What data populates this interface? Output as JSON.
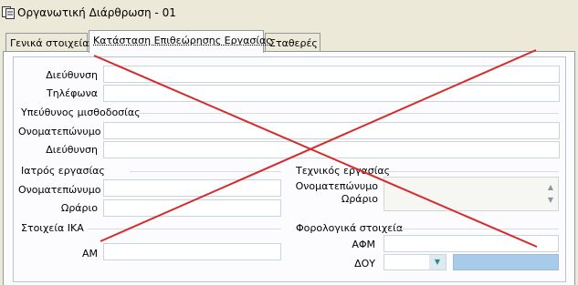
{
  "window": {
    "title": "Οργανωτική Διάρθρωση - 01",
    "icon": "app-icon"
  },
  "tabs": [
    {
      "label": "Γενικά στοιχεία",
      "active": false
    },
    {
      "label": "Κατάσταση Επιθεώρησης Εργασίας",
      "active": true
    },
    {
      "label": "Σταθερές",
      "active": false
    }
  ],
  "form": {
    "address_label": "Διεύθυνση",
    "address_value": "",
    "phones_label": "Τηλέφωνα",
    "phones_value": "",
    "payroll": {
      "heading": "Υπεύθυνος μισθοδοσίας",
      "name_label": "Ονοματεπώνυμο",
      "name_value": "",
      "address_label": "Διεύθυνση",
      "address_value": ""
    },
    "doctor": {
      "heading": "Ιατρός εργασίας",
      "name_label": "Ονοματεπώνυμο",
      "name_value": "",
      "hours_label": "Ωράριο",
      "hours_value": ""
    },
    "technician": {
      "heading": "Τεχνικός εργασίας",
      "name_label": "Ονοματεπώνυμο",
      "hours_label": "Ωράριο",
      "memo_value": ""
    },
    "ika": {
      "heading": "Στοιχεία ΙΚΑ",
      "am_label": "ΑΜ",
      "am_value": ""
    },
    "tax": {
      "heading": "Φορολογικά στοιχεία",
      "afm_label": "ΑΦΜ",
      "afm_value": "",
      "doy_label": "ΔΟΥ",
      "doy_value": "",
      "doy_description": ""
    }
  },
  "overlay": {
    "type": "cross-out",
    "color": "#d62b2b"
  },
  "icons": {
    "scroll_up": "▲",
    "scroll_down": "▼",
    "combo_arrow": "▼"
  }
}
